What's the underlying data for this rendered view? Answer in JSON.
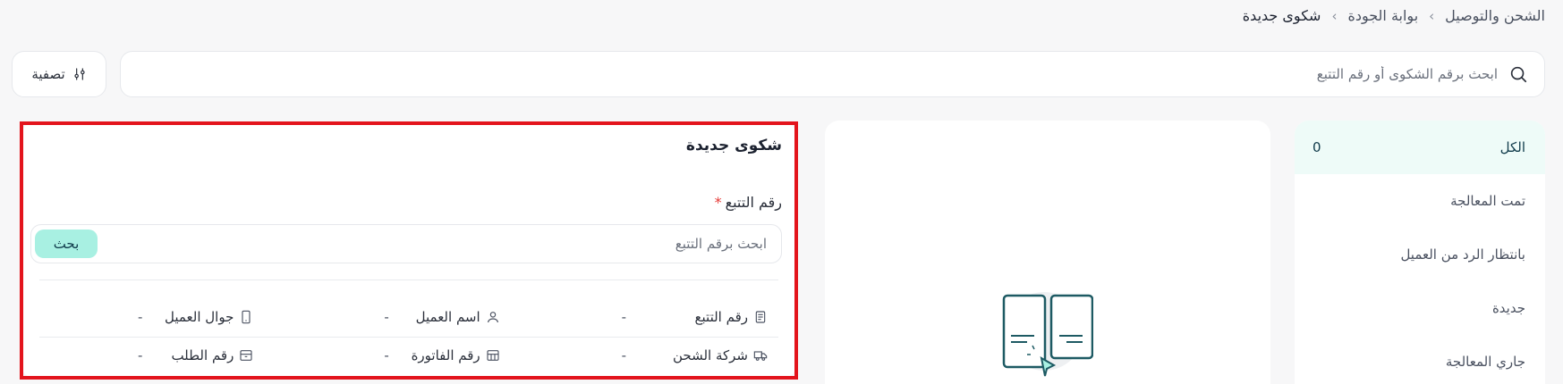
{
  "breadcrumb": {
    "items": [
      "الشحن والتوصيل",
      "بوابة الجودة"
    ],
    "current": "شكوى جديدة",
    "separator": "›"
  },
  "search": {
    "placeholder": "ابحث برقم الشكوى أو رقم التتبع",
    "icon": "search-icon"
  },
  "filter": {
    "label": "تصفية",
    "icon": "sliders-icon"
  },
  "status_list": [
    {
      "label": "الكل",
      "count": "0",
      "active": true
    },
    {
      "label": "تمت المعالجة"
    },
    {
      "label": "بانتظار الرد من العميل"
    },
    {
      "label": "جديدة"
    },
    {
      "label": "جاري المعالجة"
    }
  ],
  "complaint_form": {
    "title": "شكوى جديدة",
    "tracking_label": "رقم التتبع",
    "required_mark": "*",
    "tracking_placeholder": "ابحث برقم التتبع",
    "search_button": "بحث",
    "info_rows": [
      [
        {
          "label": "رقم التتبع",
          "value": "-",
          "icon": "receipt-icon"
        },
        {
          "label": "اسم العميل",
          "value": "-",
          "icon": "user-icon"
        },
        {
          "label": "جوال العميل",
          "value": "-",
          "icon": "phone-icon"
        }
      ],
      [
        {
          "label": "شركة الشحن",
          "value": "-",
          "icon": "truck-icon"
        },
        {
          "label": "رقم الفاتورة",
          "value": "-",
          "icon": "invoice-icon"
        },
        {
          "label": "رقم الطلب",
          "value": "-",
          "icon": "box-icon"
        }
      ]
    ]
  },
  "colors": {
    "accent": "#a8f0e2",
    "active_bg": "#eefbf8",
    "highlight": "#e3141c",
    "illustration": "#1d5a63"
  }
}
